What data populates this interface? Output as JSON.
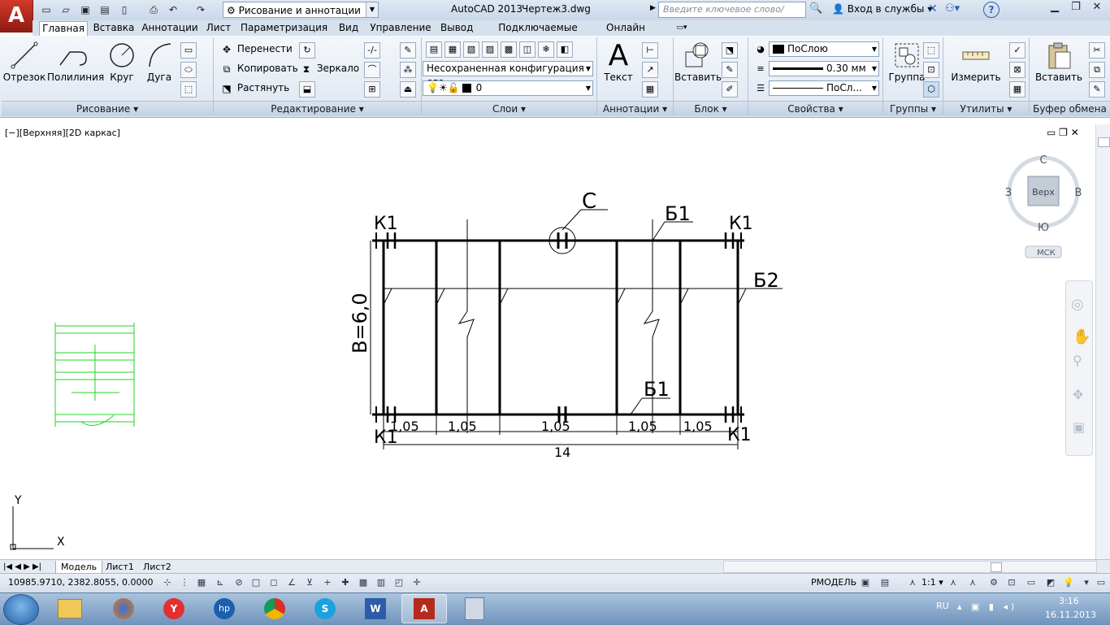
{
  "app": {
    "logo_letter": "A",
    "workspace": "Рисование и аннотации",
    "product": "AutoCAD 2013",
    "file": "Чертеж3.dwg",
    "search_placeholder": "Введите ключевое слово/фразу",
    "signin": "Вход в службы",
    "help": "?"
  },
  "tabs": [
    "Главная",
    "Вставка",
    "Аннотации",
    "Лист",
    "Параметризация",
    "Вид",
    "Управление",
    "Вывод",
    "Подключаемые модули",
    "Онлайн"
  ],
  "ribbon": {
    "draw": {
      "otrezok": "Отрезок",
      "polyline": "Полилиния",
      "circle": "Круг",
      "arc": "Дуга",
      "panel": "Рисование"
    },
    "modify": {
      "move": "Перенести",
      "copy": "Копировать",
      "stretch": "Растянуть",
      "mirror": "Зеркало",
      "panel": "Редактирование"
    },
    "layers": {
      "config": "Несохраненная конфигурация сло",
      "layer": "0",
      "panel": "Слои"
    },
    "annot": {
      "text": "Текст",
      "panel": "Аннотации"
    },
    "block": {
      "insert": "Вставить",
      "panel": "Блок"
    },
    "props": {
      "color": "ПоСлою",
      "lineweight": "0.30 мм",
      "linetype": "ПоСл...",
      "panel": "Свойства"
    },
    "groups": {
      "group": "Группа",
      "panel": "Группы"
    },
    "utils": {
      "measure": "Измерить",
      "panel": "Утилиты"
    },
    "clipboard": {
      "paste": "Вставить",
      "panel": "Буфер обмена"
    }
  },
  "viewport": {
    "label": "[−][Верхняя][2D каркас]",
    "viewcube": {
      "n": "С",
      "s": "Ю",
      "w": "З",
      "e": "В",
      "face": "Верх",
      "ucs": "МСК"
    },
    "ucs_x": "X",
    "ucs_y": "Y"
  },
  "drawing": {
    "k1": "К1",
    "c": "С",
    "b1": "Б1",
    "b2": "Б2",
    "b_dim": "В=6,0",
    "d1": "1,05",
    "d2": "1,05",
    "d3": "1,05",
    "d4": "1,05",
    "d5": "1,05",
    "total": "14"
  },
  "layout_tabs": [
    "Модель",
    "Лист1",
    "Лист2"
  ],
  "status": {
    "coords": "10985.9710, 2382.8055, 0.0000",
    "space": "РМОДЕЛЬ",
    "scale": "1:1"
  },
  "tray": {
    "lang": "RU",
    "time": "3:16",
    "date": "16.11.2013"
  }
}
